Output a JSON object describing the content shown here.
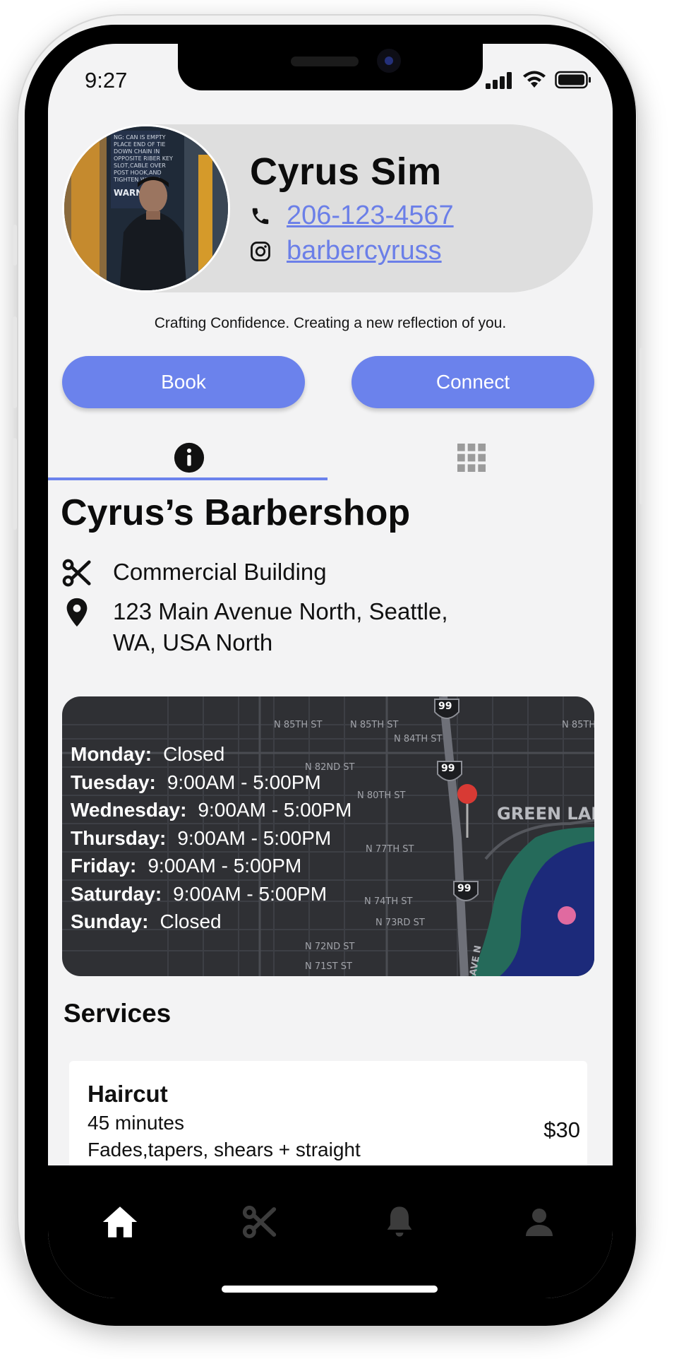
{
  "status_bar": {
    "time": "9:27"
  },
  "profile": {
    "name": "Cyrus Sim",
    "phone": "206-123-4567",
    "instagram": "barbercyruss",
    "tagline": "Crafting Confidence. Creating a new reflection of you.",
    "avatar_sign_text": "WARNING DO NOT CAR UN TIEDOW SECUR KEY"
  },
  "actions": {
    "book": "Book",
    "connect": "Connect"
  },
  "tabs": [
    {
      "icon": "info-icon",
      "active": true
    },
    {
      "icon": "grid-icon",
      "active": false
    }
  ],
  "shop": {
    "title": "Cyrus’s Barbershop",
    "type": "Commercial Building",
    "address_line1": "123 Main Avenue North, Seattle,",
    "address_line2": "WA, USA North"
  },
  "hours": [
    {
      "day": "Monday:",
      "time": "Closed"
    },
    {
      "day": "Tuesday:",
      "time": "9:00AM - 5:00PM"
    },
    {
      "day": "Wednesday:",
      "time": "9:00AM - 5:00PM"
    },
    {
      "day": "Thursday:",
      "time": "9:00AM - 5:00PM"
    },
    {
      "day": "Friday:",
      "time": "9:00AM - 5:00PM"
    },
    {
      "day": "Saturday:",
      "time": "9:00AM - 5:00PM"
    },
    {
      "day": "Sunday:",
      "time": "Closed"
    }
  ],
  "map_labels": {
    "s85": "N 85TH ST",
    "s85b": "N 85TH ST",
    "s85c": "N 85TH",
    "s84": "N 84TH ST",
    "s82": "N 82ND ST",
    "s80": "N 80TH ST",
    "s77": "N 77TH ST",
    "s74": "N 74TH ST",
    "s73": "N 73RD ST",
    "s72": "N 72ND ST",
    "s71": "N 71ST ST",
    "green_lake": "GREEN LAKE",
    "highway": "99",
    "aven": "AVE N"
  },
  "services": {
    "title": "Services",
    "items": [
      {
        "name": "Haircut",
        "duration": "45 minutes",
        "description": "Fades,tapers, shears + straight",
        "price": "$30"
      }
    ]
  },
  "nav": [
    {
      "icon": "home-icon",
      "active": true
    },
    {
      "icon": "scissors-icon",
      "active": false
    },
    {
      "icon": "bell-icon",
      "active": false
    },
    {
      "icon": "person-icon",
      "active": false
    }
  ],
  "colors": {
    "accent": "#6b82ec",
    "link": "#6b7fe8",
    "card_dark": "#2f3034",
    "background": "#f3f3f4"
  }
}
